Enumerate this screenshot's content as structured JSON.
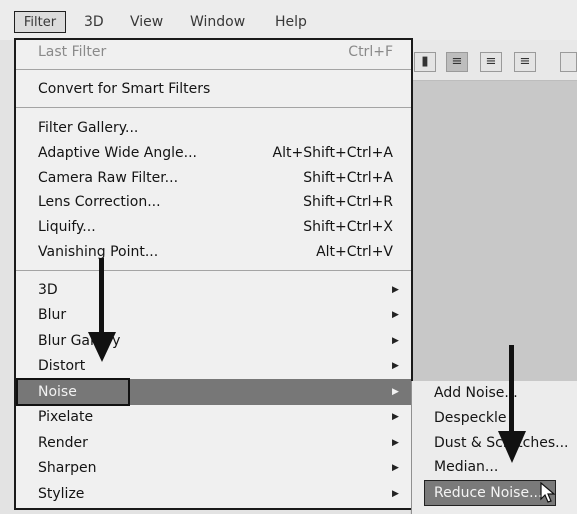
{
  "menubar": {
    "items": [
      "Filter",
      "3D",
      "View",
      "Window",
      "Help"
    ]
  },
  "filter_menu": {
    "last_filter": {
      "label": "Last Filter",
      "shortcut": "Ctrl+F"
    },
    "convert": {
      "label": "Convert for Smart Filters"
    },
    "group2": [
      {
        "label": "Filter Gallery...",
        "shortcut": ""
      },
      {
        "label": "Adaptive Wide Angle...",
        "shortcut": "Alt+Shift+Ctrl+A"
      },
      {
        "label": "Camera Raw Filter...",
        "shortcut": "Shift+Ctrl+A"
      },
      {
        "label": "Lens Correction...",
        "shortcut": "Shift+Ctrl+R"
      },
      {
        "label": "Liquify...",
        "shortcut": "Shift+Ctrl+X"
      },
      {
        "label": "Vanishing Point...",
        "shortcut": "Alt+Ctrl+V"
      }
    ],
    "group3": [
      "3D",
      "Blur",
      "Blur Gallery",
      "Distort",
      "Noise",
      "Pixelate",
      "Render",
      "Sharpen",
      "Stylize"
    ]
  },
  "noise_submenu": {
    "items": [
      "Add Noise...",
      "Despeckle",
      "Dust & Scratches...",
      "Median...",
      "Reduce Noise..."
    ],
    "selected": "Reduce Noise..."
  },
  "icons": {
    "submenu_arrow": "triangle-right-icon",
    "annotation": "down-arrow-icon",
    "cursor": "mouse-pointer-icon"
  }
}
